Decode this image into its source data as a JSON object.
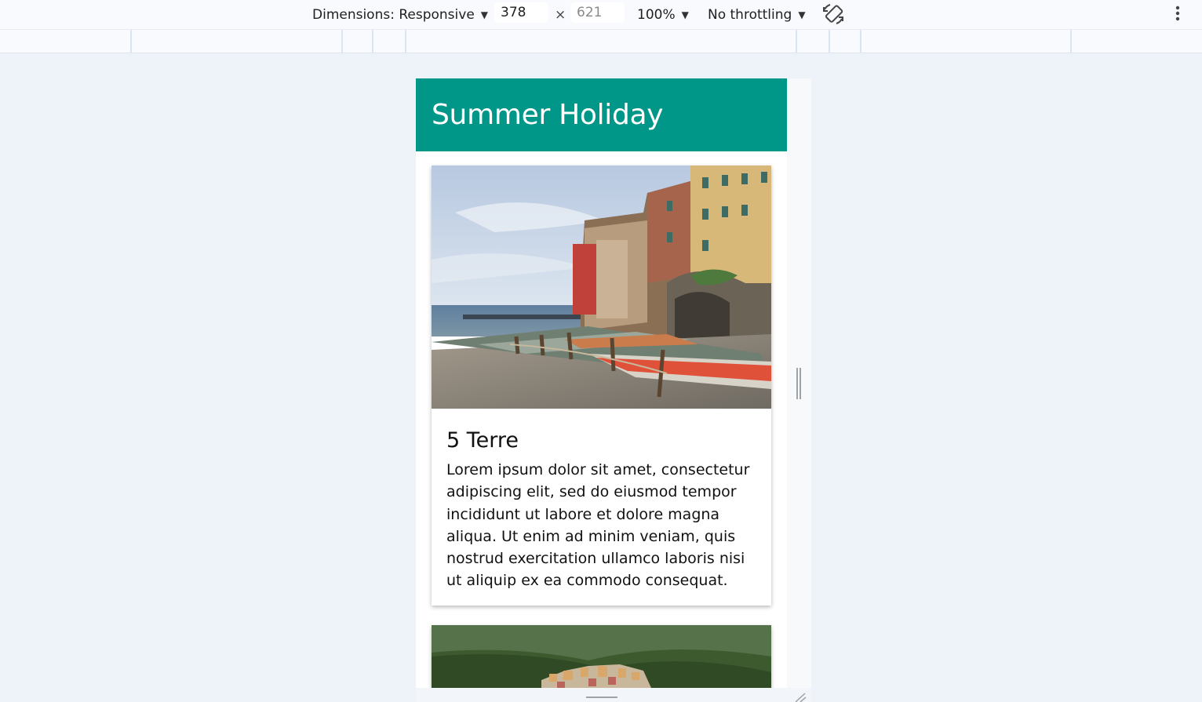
{
  "devtools": {
    "dimensions_label": "Dimensions: Responsive",
    "width_value": "378",
    "height_value": "621",
    "times_symbol": "×",
    "zoom_label": "100%",
    "throttling_label": "No throttling"
  },
  "page": {
    "header_title": "Summer Holiday",
    "header_color": "#009688",
    "cards": [
      {
        "title": "5 Terre",
        "text": "Lorem ipsum dolor sit amet, consectetur adipiscing elit, sed do eiusmod tempor incididunt ut labore et dolore magna aliqua. Ut enim ad minim veniam, quis nostrud exercitation ullamco laboris nisi ut aliquip ex ea commodo consequat."
      }
    ]
  }
}
